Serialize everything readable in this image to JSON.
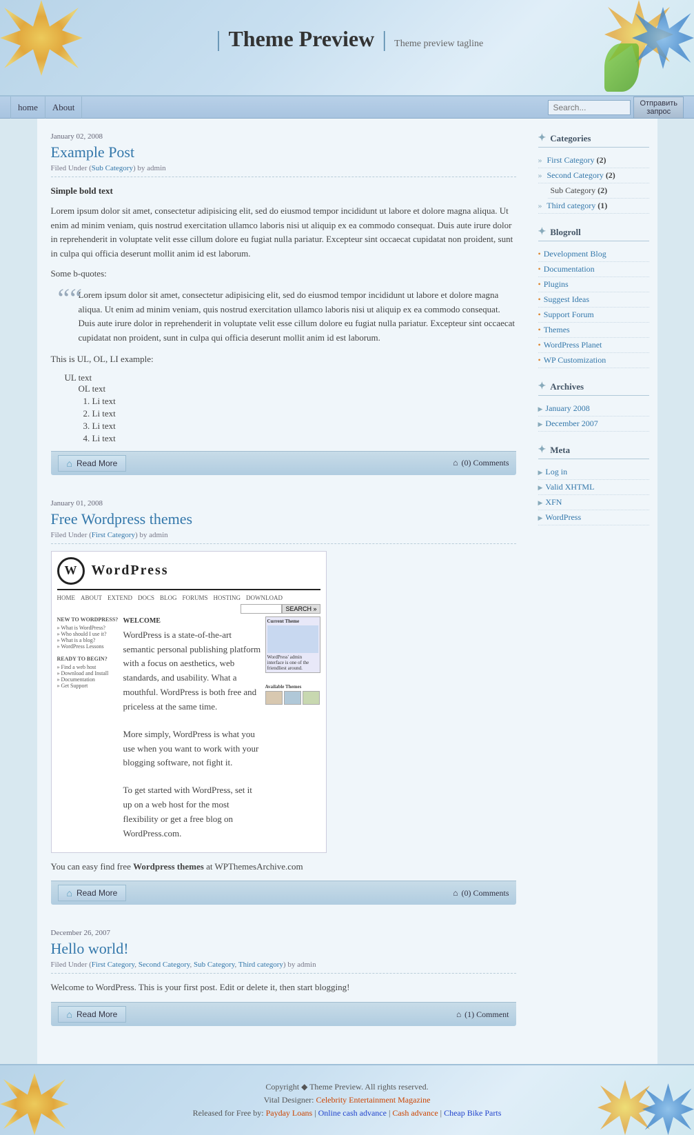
{
  "header": {
    "title": "Theme Preview",
    "sep": "|",
    "tagline": "Theme preview tagline"
  },
  "nav": {
    "links": [
      "home",
      "About"
    ],
    "search_placeholder": "Search...",
    "search_btn": "Отправить запрос"
  },
  "posts": [
    {
      "id": "post-1",
      "date": "January 02, 2008",
      "title": "Example Post",
      "meta": "Filed Under (Sub Category) by admin",
      "meta_link": "Sub Category",
      "content_bold": "Simple bold text",
      "content_para": "Lorem ipsum dolor sit amet, consectetur adipisicing elit, sed do eiusmod tempor incididunt ut labore et dolore magna aliqua. Ut enim ad minim veniam, quis nostrud exercitation ullamco laboris nisi ut aliquip ex ea commodo consequat. Duis aute irure dolor in reprehenderit in voluptate velit esse cillum dolore eu fugiat nulla pariatur. Excepteur sint occaecat cupidatat non proident, sunt in culpa qui officia deserunt mollit anim id est laborum.",
      "bquotes_label": "Some b-quotes:",
      "blockquote": "Lorem ipsum dolor sit amet, consectetur adipisicing elit, sed do eiusmod tempor incididunt ut labore et dolore magna aliqua. Ut enim ad minim veniam, quis nostrud exercitation ullamco laboris nisi ut aliquip ex ea commodo consequat. Duis aute irure dolor in reprehenderit in voluptate velit esse cillum dolore eu fugiat nulla pariatur. Excepteur sint occaecat cupidatat non proident, sunt in culpa qui officia deserunt mollit anim id est laborum.",
      "list_intro": "This is UL, OL, LI example:",
      "ul_item": "UL text",
      "ol_item": "OL text",
      "li_items": [
        "Li text",
        "Li text",
        "Li text",
        "Li text"
      ],
      "read_more": "Read More",
      "comments": "(0) Comments"
    },
    {
      "id": "post-2",
      "date": "January 01, 2008",
      "title": "Free Wordpress themes",
      "meta": "Filed Under (First Category) by admin",
      "meta_link": "First Category",
      "content_para": "You can easy find free Wordpress themes at WPThemesArchive.com",
      "read_more": "Read More",
      "comments": "(0) Comments"
    },
    {
      "id": "post-3",
      "date": "December 26, 2007",
      "title": "Hello world!",
      "meta": "Filed Under (First Category, Second Category, Sub Category, Third category) by admin",
      "meta_links": [
        "First Category",
        "Second Category",
        "Sub Category",
        "Third category"
      ],
      "content_para": "Welcome to WordPress. This is your first post. Edit or delete it, then start blogging!",
      "read_more": "Read More",
      "comments": "(1) Comment"
    }
  ],
  "sidebar": {
    "categories": {
      "title": "Categories",
      "items": [
        {
          "label": "First Category",
          "count": "(2)"
        },
        {
          "label": "Second Category",
          "count": "(2)"
        },
        {
          "sub": "Sub Category",
          "count": "(2)"
        },
        {
          "label": "Third category",
          "count": "(1)"
        }
      ]
    },
    "blogroll": {
      "title": "Blogroll",
      "items": [
        "Development Blog",
        "Documentation",
        "Plugins",
        "Suggest Ideas",
        "Support Forum",
        "Themes",
        "WordPress Planet",
        "WP Customization"
      ]
    },
    "archives": {
      "title": "Archives",
      "items": [
        "January 2008",
        "December 2007"
      ]
    },
    "meta": {
      "title": "Meta",
      "items": [
        "Log in",
        "Valid XHTML",
        "XFN",
        "WordPress"
      ]
    }
  },
  "footer": {
    "copyright": "Copyright ◆ Theme Preview. All rights reserved.",
    "vital": "Vital Designer:",
    "vital_link": "Celebrity Entertainment Magazine",
    "released": "Released for Free by:",
    "links": [
      {
        "label": "Payday Loans",
        "color": "orange"
      },
      {
        "label": "Online cash advance",
        "color": "blue"
      },
      {
        "label": "Cash advance",
        "color": "orange"
      },
      {
        "label": "Cheap Bike Parts",
        "color": "blue"
      }
    ]
  },
  "wordpress_screenshot": {
    "logo_text": "W",
    "brand": "WordPress",
    "nav_items": [
      "HOME",
      "ABOUT",
      "EXTEND",
      "DOCS",
      "BLOG",
      "FORUMS",
      "HOSTING",
      "DOWNLOAD"
    ],
    "welcome": "WELCOME",
    "welcome_text": "WordPress is a state-of-the-art semantic personal publishing platform with a focus on aesthetics, web standards, and usability. What a mouthful. WordPress is both free and priceless at the same time.",
    "current_theme": "Current Theme",
    "available_themes": "Available Themes"
  }
}
